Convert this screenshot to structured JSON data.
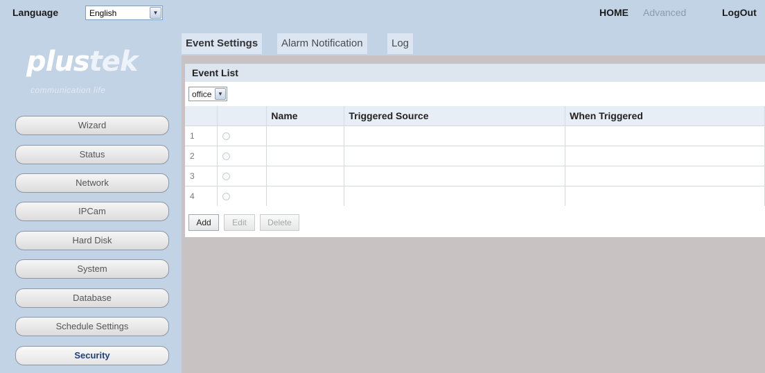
{
  "header": {
    "language_label": "Language",
    "language_value": "English",
    "nav": {
      "home": "HOME",
      "advanced": "Advanced",
      "logout": "LogOut"
    }
  },
  "brand": {
    "logo_part1": "plus",
    "logo_part2": "tek",
    "tagline": "communication life"
  },
  "sidebar": {
    "items": [
      {
        "label": "Wizard"
      },
      {
        "label": "Status"
      },
      {
        "label": "Network"
      },
      {
        "label": "IPCam"
      },
      {
        "label": "Hard Disk"
      },
      {
        "label": "System"
      },
      {
        "label": "Database"
      },
      {
        "label": "Schedule Settings"
      },
      {
        "label": "Security"
      }
    ],
    "active": "Security"
  },
  "tabs": [
    {
      "label": "Event Settings"
    },
    {
      "label": "Alarm Notification"
    },
    {
      "label": "Log"
    }
  ],
  "event_list": {
    "title": "Event List",
    "filter_value": "office",
    "columns": [
      "",
      "",
      "Name",
      "Triggered Source",
      "When Triggered"
    ],
    "rows": [
      {
        "num": "1",
        "name": "",
        "source": "",
        "when": ""
      },
      {
        "num": "2",
        "name": "",
        "source": "",
        "when": ""
      },
      {
        "num": "3",
        "name": "",
        "source": "",
        "when": ""
      },
      {
        "num": "4",
        "name": "",
        "source": "",
        "when": ""
      }
    ],
    "buttons": {
      "add": "Add",
      "edit": "Edit",
      "delete": "Delete"
    }
  }
}
